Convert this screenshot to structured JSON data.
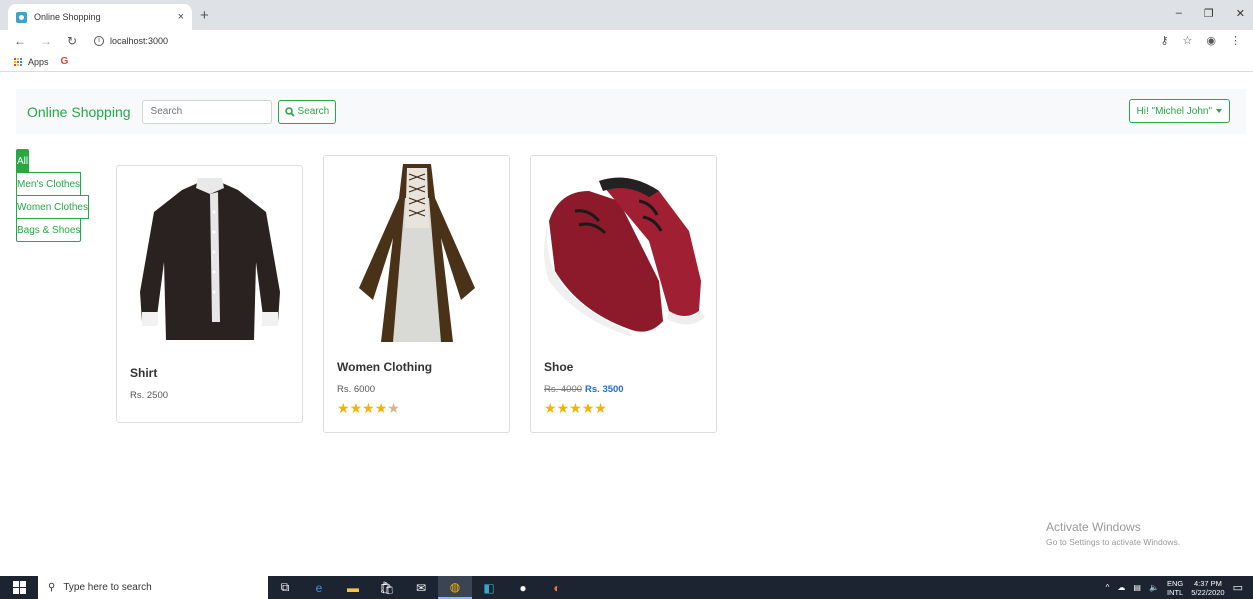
{
  "browser": {
    "tab_title": "Online Shopping",
    "tab_close": "×",
    "new_tab": "+",
    "url": "localhost:3000",
    "bookmarks_apps": "Apps",
    "bookmarks_google": "G",
    "window_controls": [
      "–",
      "❐",
      "✕"
    ]
  },
  "navbar": {
    "brand": "Online Shopping",
    "search_placeholder": "Search",
    "search_button": "Search",
    "user_menu": "Hi! \"Michel John\""
  },
  "categories": [
    {
      "label": "All",
      "active": true
    },
    {
      "label": "Men's Clothes",
      "active": false
    },
    {
      "label": "Women Clothes",
      "active": false
    },
    {
      "label": "Bags & Shoes",
      "active": false
    }
  ],
  "products": [
    {
      "title": "Shirt",
      "price": "Rs. 2500"
    },
    {
      "title": "Women Clothing",
      "price": "Rs. 6000",
      "rating": 4.5
    },
    {
      "title": "Shoe",
      "old_price": "Rs. 4000",
      "new_price": "Rs. 3500",
      "rating": 5
    }
  ],
  "watermark": {
    "title": "Activate Windows",
    "subtitle": "Go to Settings to activate Windows."
  },
  "taskbar": {
    "search_text": "Type here to search",
    "lang_top": "ENG",
    "lang_bottom": "INTL",
    "time": "4:37 PM",
    "date": "5/22/2020"
  },
  "colors": {
    "accent": "#28a745",
    "navbar_bg": "#f8f9fa",
    "star": "#f5b301",
    "sale_price": "#1e6ed8"
  }
}
